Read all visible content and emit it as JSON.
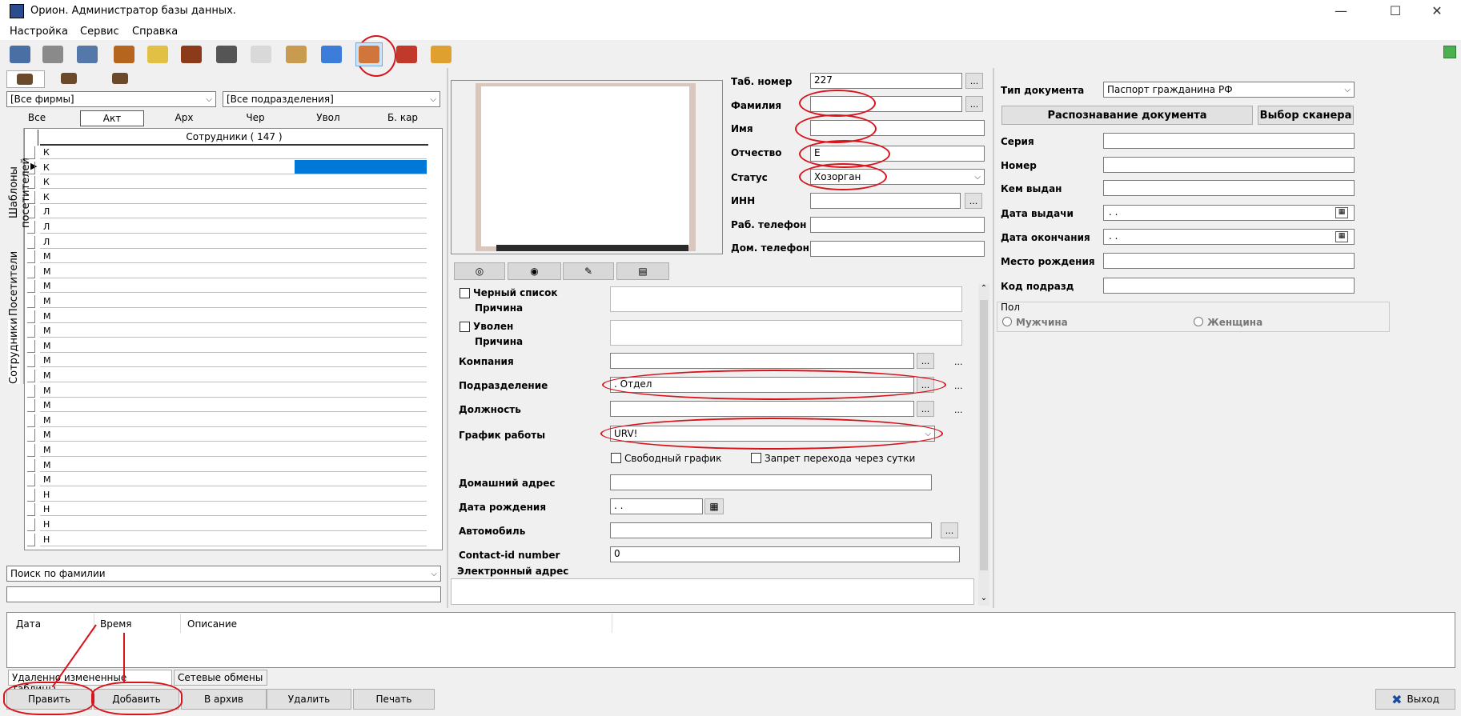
{
  "window": {
    "title": "Орион. Администратор базы данных.",
    "minimize": "—",
    "maximize": "☐",
    "close": "✕"
  },
  "menu": [
    "Настройка",
    "Сервис",
    "Справка"
  ],
  "toolbar": [
    "monitor-icon",
    "calendar-icon",
    "server-icon",
    "walk-icon",
    "notes-icon",
    "wheel-icon",
    "train-icon",
    "house-icon",
    "visitors-icon",
    "add-card-icon",
    "employees-icon",
    "car-icon",
    "key-icon"
  ],
  "left": {
    "companies": "[Все фирмы]",
    "departments": "[Все подразделения]",
    "filters": [
      "Все",
      "Акт",
      "Арх",
      "Чер",
      "Увол",
      "Б. кар"
    ],
    "grid_header": "Сотрудники ( 147 )",
    "row_letters": [
      "К",
      "К",
      "К",
      "К",
      "Л",
      "Л",
      "Л",
      "М",
      "М",
      "М",
      "М",
      "М",
      "М",
      "М",
      "М",
      "М",
      "М",
      "М",
      "М",
      "М",
      "М",
      "М",
      "М",
      "Н",
      "Н",
      "Н",
      "Н"
    ],
    "vtabs": [
      "Шаблоны посетителей",
      "Посетители",
      "Сотрудники"
    ],
    "search_mode": "Поиск по фамилии",
    "search_value": ""
  },
  "form": {
    "tab_number_label": "Таб. номер",
    "tab_number": "227",
    "surname_label": "Фамилия",
    "surname": "",
    "name_label": "Имя",
    "name": "",
    "patronymic_label": "Отчество",
    "patronymic": "Е",
    "status_label": "Статус",
    "status": "Хозорган",
    "inn_label": "ИНН",
    "inn": "",
    "work_phone_label": "Раб. телефон",
    "work_phone": "",
    "home_phone_label": "Дом. телефон",
    "home_phone": "",
    "blacklist_label": "Черный список",
    "reason_label": "Причина",
    "fired_label": "Уволен",
    "company_label": "Компания",
    "company": "",
    "department_label": "Подразделение",
    "department": ". Отдел",
    "position_label": "Должность",
    "position": "",
    "schedule_label": "График работы",
    "schedule": "URV!",
    "free_schedule": "Свободный график",
    "no_day_cross": "Запрет перехода через сутки",
    "address_label": "Домашний адрес",
    "address": "",
    "birth_label": "Дата рождения",
    "birth": " . .",
    "car_label": "Автомобиль",
    "car": "",
    "contact_label": "Contact-id number",
    "contact": "0",
    "email_label": "Электронный адрес",
    "ellipsis": "...",
    "more": "...",
    "dash_more": "..."
  },
  "doc": {
    "type_label": "Тип документа",
    "type": "Паспорт гражданина РФ",
    "recognize": "Распознавание документа",
    "scanner": "Выбор сканера",
    "series_label": "Серия",
    "number_label": "Номер",
    "issuer_label": "Кем выдан",
    "issue_date_label": "Дата выдачи",
    "issue_date": " . .",
    "end_date_label": "Дата окончания",
    "end_date": " . .",
    "birthplace_label": "Место рождения",
    "code_label": "Код подразд",
    "sex_label": "Пол",
    "male": "Мужчина",
    "female": "Женщина"
  },
  "log": {
    "columns": [
      "Дата",
      "Время",
      "Описание"
    ],
    "tabs": [
      "Удаленно измененные таблицы",
      "Сетевые обмены"
    ]
  },
  "bottom": {
    "edit": "Править",
    "add": "Добавить",
    "archive": "В архив",
    "delete": "Удалить",
    "print": "Печать",
    "exit": "Выход"
  },
  "colors": {
    "accent": "#0078d7",
    "annotation": "#d8131b"
  }
}
